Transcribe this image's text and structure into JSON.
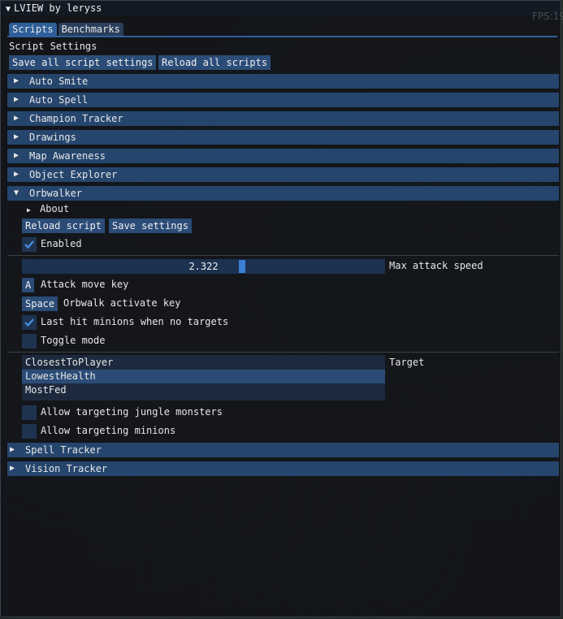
{
  "window": {
    "title": "LVIEW by leryss",
    "fps_overlay": "FPS:19"
  },
  "tabs": [
    {
      "label": "Scripts",
      "active": true
    },
    {
      "label": "Benchmarks",
      "active": false
    }
  ],
  "section_title": "Script Settings",
  "toolbar": {
    "save_all_label": "Save all script settings",
    "reload_all_label": "Reload all scripts"
  },
  "scripts": [
    {
      "label": "Auto Smite",
      "expanded": false
    },
    {
      "label": "Auto Spell",
      "expanded": false
    },
    {
      "label": "Champion Tracker",
      "expanded": false
    },
    {
      "label": "Drawings",
      "expanded": false
    },
    {
      "label": "Map Awareness",
      "expanded": false
    },
    {
      "label": "Object Explorer",
      "expanded": false
    },
    {
      "label": "Orbwalker",
      "expanded": true
    }
  ],
  "orbwalker": {
    "about_label": "About",
    "reload_label": "Reload script",
    "save_label": "Save settings",
    "enabled_label": "Enabled",
    "enabled": true,
    "max_attack_speed": {
      "value": "2.322",
      "label": "Max attack speed"
    },
    "attack_move_key": {
      "key": "A",
      "label": "Attack move key"
    },
    "orbwalk_key": {
      "key": "Space",
      "label": "Orbwalk activate key"
    },
    "last_hit": {
      "label": "Last hit minions when no targets",
      "checked": true
    },
    "toggle_mode": {
      "label": "Toggle mode",
      "checked": false
    },
    "target": {
      "label": "Target",
      "options": [
        "ClosestToPlayer",
        "LowestHealth",
        "MostFed"
      ],
      "selected": "LowestHealth"
    },
    "allow_jungle": {
      "label": "Allow targeting jungle monsters",
      "checked": false
    },
    "allow_minions": {
      "label": "Allow targeting minions",
      "checked": false
    }
  },
  "more_scripts": [
    {
      "label": "Spell Tracker",
      "expanded": false
    },
    {
      "label": "Vision Tracker",
      "expanded": false
    }
  ],
  "colors": {
    "accent": "#2e5f99",
    "header": "#25456d",
    "button": "#2b4c77",
    "check": "#4a90e2"
  }
}
